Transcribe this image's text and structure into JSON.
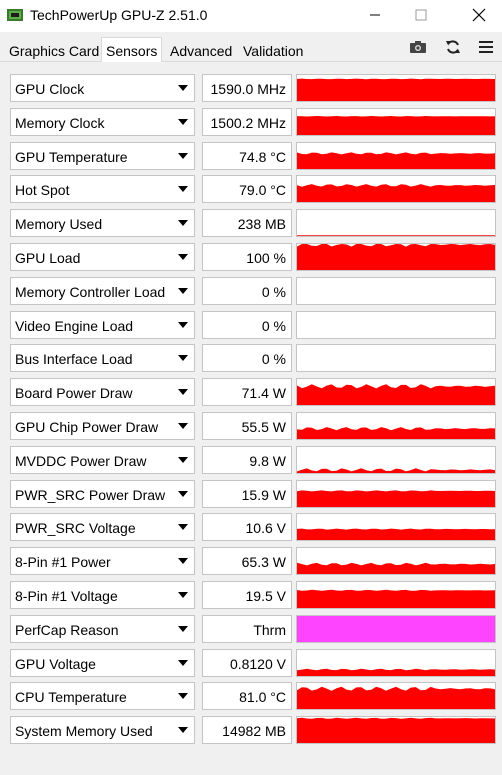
{
  "window": {
    "title": "TechPowerUp GPU-Z 2.51.0"
  },
  "tabs": [
    {
      "label": "Graphics Card",
      "active": false
    },
    {
      "label": "Sensors",
      "active": true
    },
    {
      "label": "Advanced",
      "active": false
    },
    {
      "label": "Validation",
      "active": false
    }
  ],
  "toolbar": {
    "icons": [
      "camera-icon",
      "refresh-icon",
      "menu-icon"
    ]
  },
  "colors": {
    "graph_fill": "#ff0000",
    "perfcap_fill": "#ff44ff"
  },
  "sensors": [
    {
      "name": "GPU Clock",
      "value": "1590.0 MHz",
      "level": 0.85,
      "variation": 0.01
    },
    {
      "name": "Memory Clock",
      "value": "1500.2 MHz",
      "level": 0.72,
      "variation": 0.01
    },
    {
      "name": "GPU Temperature",
      "value": "74.8 °C",
      "level": 0.6,
      "variation": 0.04
    },
    {
      "name": "Hot Spot",
      "value": "79.0 °C",
      "level": 0.64,
      "variation": 0.05
    },
    {
      "name": "Memory Used",
      "value": "238 MB",
      "level": 0.03,
      "variation": 0.0
    },
    {
      "name": "GPU Load",
      "value": "100 %",
      "level": 0.98,
      "variation": 0.08
    },
    {
      "name": "Memory Controller Load",
      "value": "0 %",
      "level": 0.0,
      "variation": 0.0
    },
    {
      "name": "Video Engine Load",
      "value": "0 %",
      "level": 0.0,
      "variation": 0.0
    },
    {
      "name": "Bus Interface Load",
      "value": "0 %",
      "level": 0.0,
      "variation": 0.0
    },
    {
      "name": "Board Power Draw",
      "value": "71.4 W",
      "level": 0.72,
      "variation": 0.08
    },
    {
      "name": "GPU Chip Power Draw",
      "value": "55.5 W",
      "level": 0.4,
      "variation": 0.06
    },
    {
      "name": "MVDDC Power Draw",
      "value": "9.8 W",
      "level": 0.12,
      "variation": 0.06
    },
    {
      "name": "PWR_SRC Power Draw",
      "value": "15.9 W",
      "level": 0.62,
      "variation": 0.02
    },
    {
      "name": "PWR_SRC Voltage",
      "value": "10.6 V",
      "level": 0.42,
      "variation": 0.02
    },
    {
      "name": "8-Pin #1 Power",
      "value": "65.3 W",
      "level": 0.38,
      "variation": 0.05
    },
    {
      "name": "8-Pin #1 Voltage",
      "value": "19.5 V",
      "level": 0.68,
      "variation": 0.02
    },
    {
      "name": "PerfCap Reason",
      "value": "Thrm",
      "level": 1.0,
      "variation": 0.0,
      "color": "perfcap"
    },
    {
      "name": "GPU Voltage",
      "value": "0.8120 V",
      "level": 0.25,
      "variation": 0.03
    },
    {
      "name": "CPU Temperature",
      "value": "81.0 °C",
      "level": 0.78,
      "variation": 0.08
    },
    {
      "name": "System Memory Used",
      "value": "14982 MB",
      "level": 0.95,
      "variation": 0.02
    }
  ]
}
